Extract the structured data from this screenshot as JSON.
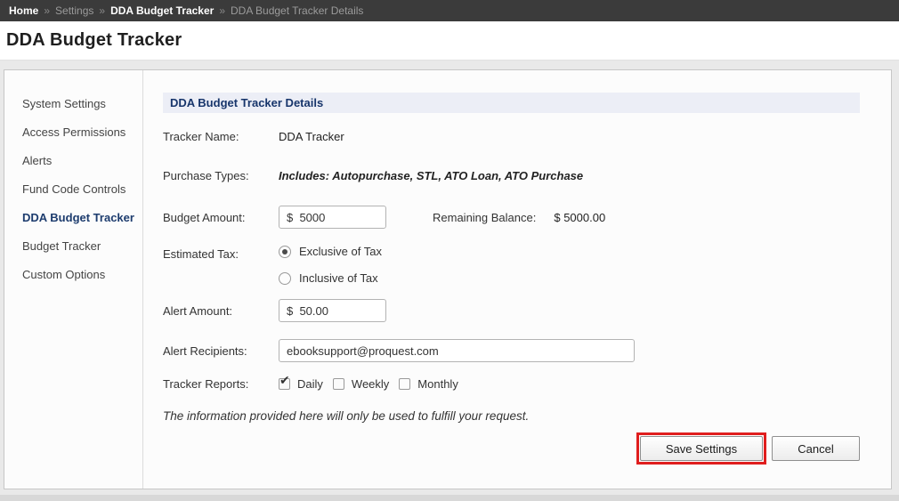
{
  "breadcrumb": {
    "separator": "»",
    "items": [
      {
        "label": "Home",
        "emphasis": true
      },
      {
        "label": "Settings",
        "emphasis": false
      },
      {
        "label": "DDA Budget Tracker",
        "emphasis": true
      },
      {
        "label": "DDA Budget Tracker Details",
        "emphasis": false
      }
    ]
  },
  "page_title": "DDA Budget Tracker",
  "sidebar": {
    "items": [
      {
        "label": "System Settings",
        "active": false
      },
      {
        "label": "Access Permissions",
        "active": false
      },
      {
        "label": "Alerts",
        "active": false
      },
      {
        "label": "Fund Code Controls",
        "active": false
      },
      {
        "label": "DDA Budget Tracker",
        "active": true
      },
      {
        "label": "Budget Tracker",
        "active": false
      },
      {
        "label": "Custom Options",
        "active": false
      }
    ]
  },
  "panel": {
    "title": "DDA Budget Tracker Details",
    "fields": {
      "tracker_name": {
        "label": "Tracker Name:",
        "value": "DDA Tracker"
      },
      "purchase_types": {
        "label": "Purchase Types:",
        "value": "Includes: Autopurchase, STL, ATO Loan, ATO Purchase"
      },
      "budget_amount": {
        "label": "Budget Amount:",
        "value": "$  5000"
      },
      "remaining_balance": {
        "label": "Remaining Balance:",
        "value": "$ 5000.00"
      },
      "estimated_tax": {
        "label": "Estimated Tax:",
        "options": [
          {
            "label": "Exclusive of Tax",
            "selected": true
          },
          {
            "label": "Inclusive of Tax",
            "selected": false
          }
        ]
      },
      "alert_amount": {
        "label": "Alert Amount:",
        "value": "$  50.00"
      },
      "alert_recipients": {
        "label": "Alert Recipients:",
        "value": "ebooksupport@proquest.com"
      },
      "tracker_reports": {
        "label": "Tracker Reports:",
        "options": [
          {
            "label": "Daily",
            "checked": true
          },
          {
            "label": "Weekly",
            "checked": false
          },
          {
            "label": "Monthly",
            "checked": false
          }
        ]
      }
    },
    "note": "The information provided here will only be used to fulfill your request.",
    "buttons": {
      "save": "Save Settings",
      "cancel": "Cancel"
    }
  },
  "icons": {
    "checkmark": "✔"
  },
  "colors": {
    "breadcrumb_bg": "#3b3b3b",
    "panel_header_bg": "#eceef6",
    "accent_navy": "#17356b",
    "annotation_red": "#e01e1e"
  }
}
